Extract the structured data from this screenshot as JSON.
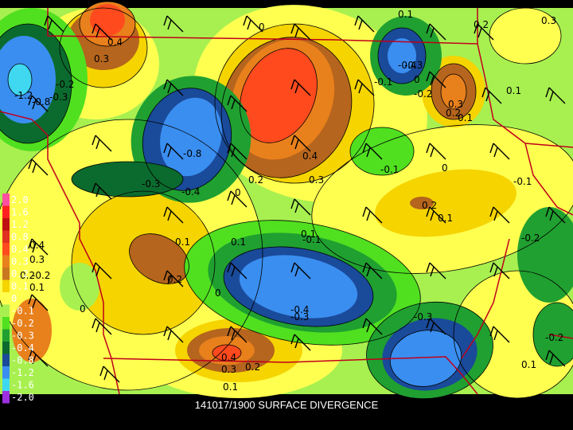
{
  "title": "141017/1900 SURFACE DIVERGENCE",
  "palette": {
    "bg": "#000000",
    "boundary": "#c0001a",
    "p2": "#b5651d",
    "p3": "#c8781e",
    "p4": "#e8801c",
    "p5": "#ff4a1e",
    "p1": "#f5d400",
    "p0": "#ffff50",
    "n0": "#a8f050",
    "n1": "#50e020",
    "n2": "#20a030",
    "n3": "#0b6b2e",
    "n4": "#1a4a9a",
    "n8": "#3a8ef0",
    "n12": "#40d8f0",
    "n16": "#30e0e0",
    "n20": "#9c30e0"
  },
  "legend": [
    {
      "label": "2.0",
      "color": "#ff4fa0"
    },
    {
      "label": "1.6",
      "color": "#ff2020"
    },
    {
      "label": "1.2",
      "color": "#c01010"
    },
    {
      "label": "0.8",
      "color": "#e03020"
    },
    {
      "label": "0.4",
      "color": "#ff4a1e"
    },
    {
      "label": "0.3",
      "color": "#e8801c"
    },
    {
      "label": "0.2",
      "color": "#c8781e"
    },
    {
      "label": "0.1",
      "color": "#f5d400"
    },
    {
      "label": "0",
      "color": "#ffff50"
    },
    {
      "label": "-0.1",
      "color": "#a8f050"
    },
    {
      "label": "-0.2",
      "color": "#50e020"
    },
    {
      "label": "-0.3",
      "color": "#20a030"
    },
    {
      "label": "-0.4",
      "color": "#0b6b2e"
    },
    {
      "label": "-0.8",
      "color": "#1a4a9a"
    },
    {
      "label": "-1.2",
      "color": "#3a8ef0"
    },
    {
      "label": "-1.6",
      "color": "#40d8f0"
    },
    {
      "label": "-2.0",
      "color": "#9c30e0"
    }
  ],
  "contour_labels": [
    "0.4",
    "0.3",
    "0",
    "0.1",
    "0.3",
    "0.2",
    "-1.2",
    "-0.8",
    "-0.3",
    "-0.2",
    "-0.4",
    "-0.3",
    "-0.2",
    "-0.1",
    "0",
    "0.3",
    "0.2",
    "0.1",
    "0.1",
    "-0.8",
    "0.2",
    "0.4",
    "0.3",
    "-0.3",
    "-0.4",
    "0",
    "-0.1",
    "0",
    "-0.1",
    "0.2",
    "0.1",
    "-0.2",
    "0.1",
    "0.1",
    "0.1",
    "-0.1",
    "-0.2",
    "0.2",
    "0",
    "-0.4",
    "-0.3",
    "-0.3",
    "0.4",
    "0.3",
    "0.2",
    "0.1",
    "-0.2",
    "0.1",
    "0.4",
    "0.3",
    "0.2",
    "0.1",
    "0"
  ]
}
